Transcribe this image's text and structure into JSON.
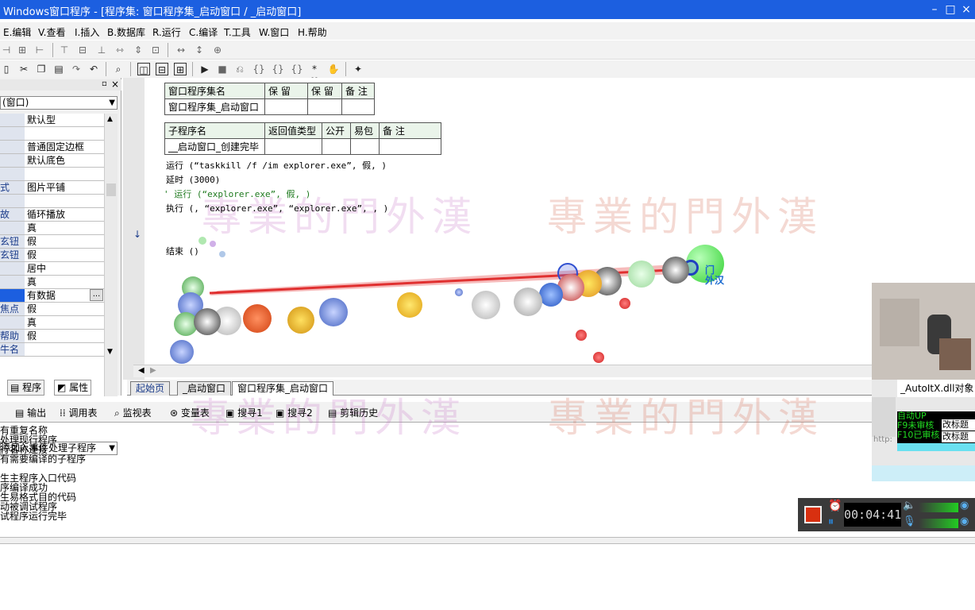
{
  "window": {
    "title": "Windows窗口程序 - [程序集: 窗口程序集_启动窗口 / _启动窗口]",
    "minimize": "–",
    "maximize": "□",
    "close": "×"
  },
  "menu": [
    "E.编辑",
    "V.查看",
    "I.插入",
    "B.数据库",
    "R.运行",
    "C.编译",
    "T.工具",
    "W.窗口",
    "H.帮助"
  ],
  "properties": {
    "selected_object": "(窗口)",
    "rows": [
      {
        "key": "",
        "value": "默认型"
      },
      {
        "key": "",
        "value": ""
      },
      {
        "key": "",
        "value": "普通固定边框"
      },
      {
        "key": "",
        "value": "默认底色"
      },
      {
        "key": "",
        "value": ""
      },
      {
        "key": "式",
        "value": "图片平铺"
      },
      {
        "key": "",
        "value": ""
      },
      {
        "key": "故",
        "value": "循环播放"
      },
      {
        "key": "",
        "value": "真"
      },
      {
        "key": "玄钮",
        "value": "假"
      },
      {
        "key": "玄钮",
        "value": "假"
      },
      {
        "key": "",
        "value": "居中"
      },
      {
        "key": "",
        "value": "真"
      },
      {
        "key": "",
        "value": "有数据"
      },
      {
        "key": "焦点",
        "value": "假"
      },
      {
        "key": "",
        "value": "真"
      },
      {
        "key": "帮助",
        "value": "假"
      },
      {
        "key": "牛名",
        "value": ""
      }
    ],
    "ellipsis": "...",
    "event_select": "添加入事件处理子程序",
    "tabs": [
      "程序",
      "属性"
    ]
  },
  "editor": {
    "assembly_table": {
      "header": [
        "窗口程序集名",
        "保 留",
        "保 留",
        "备 注"
      ],
      "row": [
        "窗口程序集_启动窗口",
        "",
        "",
        ""
      ]
    },
    "sub_table": {
      "header": [
        "子程序名",
        "返回值类型",
        "公开",
        "易包",
        "备 注"
      ],
      "row": [
        "__启动窗口_创建完毕",
        "",
        "",
        "",
        ""
      ]
    },
    "code": [
      "运行 (“taskkill /f /im explorer.exe”, 假, )",
      "延时 (3000)",
      "' 运行 (“explorer.exe”, 假, )",
      "执行 (, “explorer.exe”, “explorer.exe”, , )",
      "结束 ()"
    ],
    "cursor_label": "门\n外汉",
    "watermark": "專業的門外漢",
    "tabs": [
      "起始页",
      "_启动窗口",
      "窗口程序集_启动窗口"
    ]
  },
  "output": {
    "tabs": [
      "输出",
      "调用表",
      "监视表",
      "变量表",
      "搜寻1",
      "搜寻2",
      "剪辑历史"
    ],
    "lines": [
      "有重复名称",
      "处理现行程序",
      "行名称连接",
      "有需要编译的子程序",
      "",
      "生主程序入口代码",
      "序编译成功",
      "生易格式目的代码",
      "动被调试程序",
      "试程序运行完毕"
    ]
  },
  "side": {
    "autoit": "_AutoItX.dll对象",
    "hotkeys": [
      {
        "label": "自动UP",
        "btn": ""
      },
      {
        "label": "F9未审核",
        "btn": "改标题"
      },
      {
        "label": "F10已审核",
        "btn": "改标题"
      }
    ],
    "http": "http:"
  },
  "recorder": {
    "timer": "00:04:41"
  },
  "colors": {
    "titlebar": "#1c5fe0",
    "laser": "#e03030",
    "keyword": "#1a3b8a",
    "comment": "#1f7a1f",
    "hotkey_green": "#22dd22"
  }
}
